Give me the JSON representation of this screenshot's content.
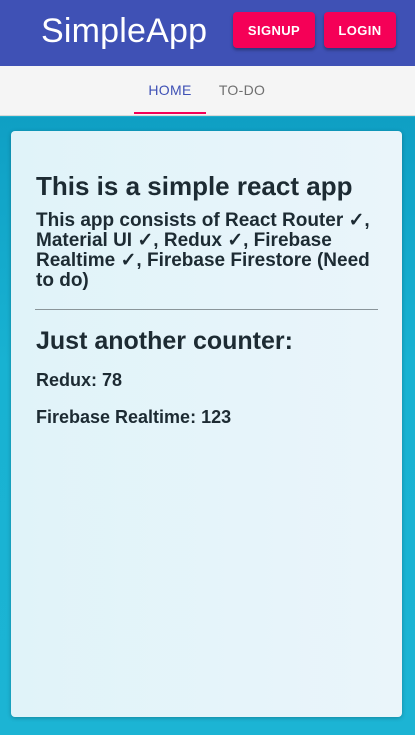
{
  "appbar": {
    "title": "SimpleApp",
    "signup_label": "SIGNUP",
    "login_label": "LOGIN",
    "primary_color": "#3f51b5",
    "accent_color": "#f50057"
  },
  "tabs": [
    {
      "label": "HOME",
      "active": true
    },
    {
      "label": "TO-DO",
      "active": false
    }
  ],
  "card": {
    "heading": "This is a simple react app",
    "description": "This app consists of React Router ✓, Material UI ✓, Redux ✓, Firebase Realtime ✓, Firebase Firestore (Need to do)",
    "counter_heading": "Just another counter:",
    "redux_counter": "Redux: 78",
    "firebase_counter": "Firebase Realtime: 123"
  }
}
